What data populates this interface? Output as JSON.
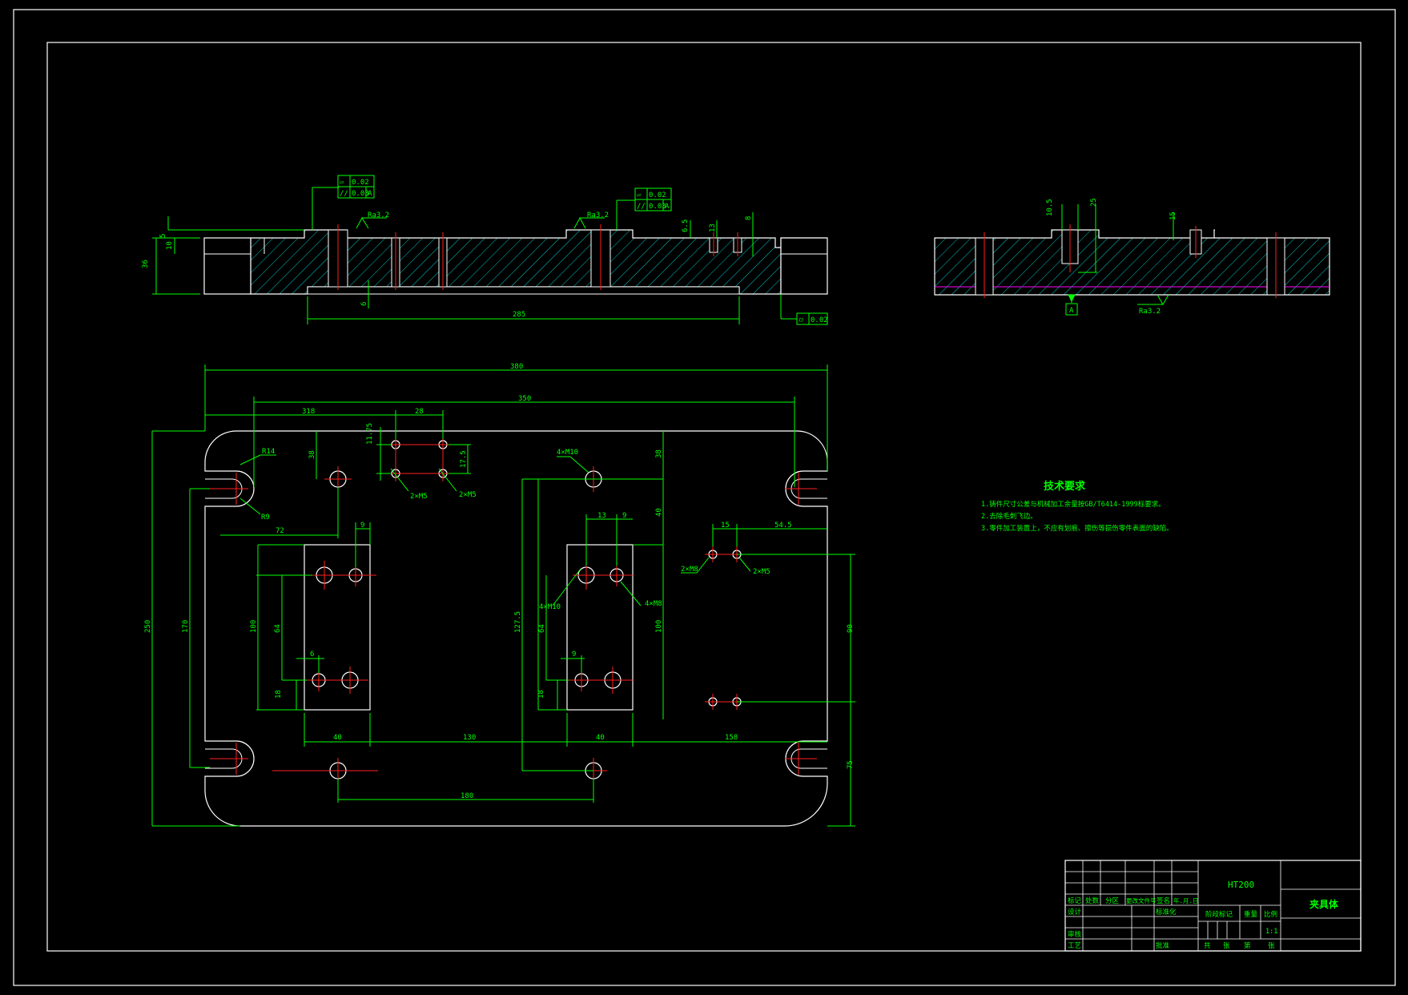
{
  "colors": {
    "background": "#000000",
    "border": "#ffffff",
    "dimension": "#00ff00",
    "hatch": "#00c8c8",
    "center": "#ff2020",
    "outline": "#ffffff",
    "phantom": "#ff00ff"
  },
  "front_view": {
    "flatness_1": "0.02",
    "parallel_1": "0.03",
    "datum_1": "A",
    "flatness_2": "0.02",
    "parallel_2": "0.03",
    "datum_2": "A",
    "roughness_1": "Ra3.2",
    "roughness_2": "Ra3.2",
    "dim_total_h": "36",
    "dim_step_5": "5",
    "dim_step_10": "10",
    "dim_6_5": "6.5",
    "dim_13": "13",
    "dim_8": "8",
    "dim_6": "6",
    "dim_285": "285",
    "cyl_symbol": "⌭",
    "cyl_value": "0.02"
  },
  "side_view": {
    "dim_r10_5": "10.5",
    "dim_25": "25",
    "dim_15": "15",
    "datum": "A",
    "roughness": "Ra3.2"
  },
  "plan_view": {
    "dim_380": "380",
    "dim_350": "350",
    "dim_318": "318",
    "dim_28": "28",
    "dim_11_75": "11.75",
    "dim_17_5": "17.5",
    "dim_r14": "R14",
    "dim_r9": "R9",
    "dim_72": "72",
    "dim_9a": "9",
    "dim_38a": "38",
    "thread_2m5_a": "2×M5",
    "thread_2m5_b": "2×M5",
    "thread_4m10_top": "4×M10",
    "dim_38b": "38",
    "dim_40a": "40",
    "dim_13": "13",
    "dim_9b": "9",
    "dim_54_5": "54.5",
    "dim_15": "15",
    "thread_2m8": "2×M8",
    "thread_2m5_c": "2×M5",
    "thread_4m10_mid": "4×M10",
    "thread_4m8": "4×M8",
    "dim_250": "250",
    "dim_170": "170",
    "dim_100a": "100",
    "dim_64a": "64",
    "dim_6a": "6",
    "dim_18a": "18",
    "dim_127_5": "127.5",
    "dim_64b": "64",
    "dim_100b": "100",
    "dim_9c": "9",
    "dim_18b": "18",
    "dim_90": "90",
    "dim_40b": "40",
    "dim_130": "130",
    "dim_40c": "40",
    "dim_158": "158",
    "dim_180": "180",
    "dim_75": "75"
  },
  "tech_requirements": {
    "title": "技术要求",
    "items": [
      "1.铸件尺寸公差与机械加工余量按GB/T6414-1999标要求。",
      "2.去除毛刺飞边。",
      "3.零件加工装置上，不应有划痕、擦伤等损伤零件表面的缺陷。"
    ]
  },
  "title_block": {
    "material": "HT200",
    "part_name": "夹具体",
    "mark": "标记",
    "count": "处数",
    "zone": "分区",
    "change_doc": "更改文件号",
    "sign": "签名",
    "date": "年.月.日",
    "design": "设计",
    "standardization": "标准化",
    "stage_mark": "阶段标记",
    "weight": "重量",
    "scale_label": "比例",
    "scale_value": "1:1",
    "review": "审核",
    "process": "工艺",
    "approve": "批准",
    "sheet_total": "共",
    "sheet_unit": "张",
    "sheet_no": "第",
    "sheet_unit2": "张"
  }
}
